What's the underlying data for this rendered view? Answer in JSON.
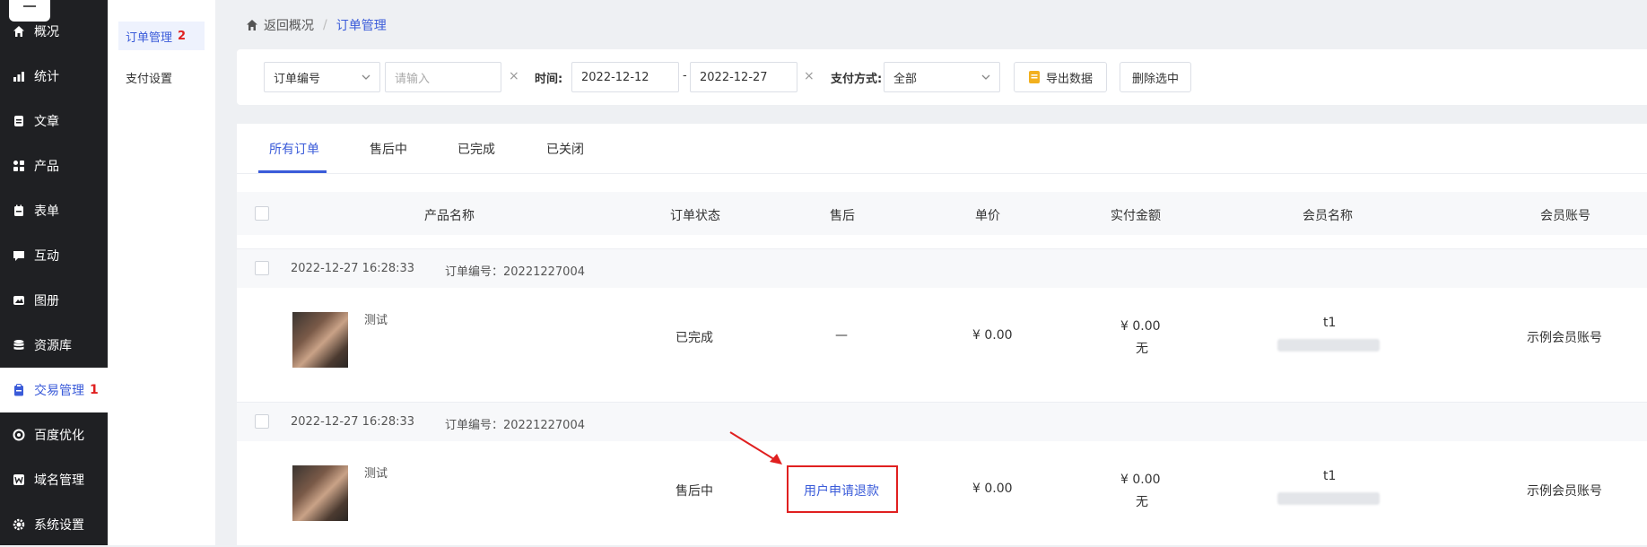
{
  "sidebar": {
    "items": [
      {
        "label": "概况",
        "icon": "home-icon"
      },
      {
        "label": "统计",
        "icon": "chart-icon"
      },
      {
        "label": "文章",
        "icon": "article-icon"
      },
      {
        "label": "产品",
        "icon": "grid-icon"
      },
      {
        "label": "表单",
        "icon": "form-icon"
      },
      {
        "label": "互动",
        "icon": "chat-icon"
      },
      {
        "label": "图册",
        "icon": "gallery-icon"
      },
      {
        "label": "资源库",
        "icon": "database-icon"
      },
      {
        "label": "交易管理",
        "icon": "clipboard-icon",
        "badge": "1",
        "active": true
      },
      {
        "label": "百度优化",
        "icon": "refresh-icon"
      },
      {
        "label": "域名管理",
        "icon": "w-icon"
      },
      {
        "label": "系统设置",
        "icon": "gear-icon"
      }
    ]
  },
  "submenu": {
    "items": [
      {
        "label": "订单管理",
        "badge": "2",
        "active": true
      },
      {
        "label": "支付设置"
      }
    ]
  },
  "breadcrumb": {
    "back": "返回概况",
    "separator": "/",
    "current": "订单管理"
  },
  "filters": {
    "field_select": "订单编号",
    "search_placeholder": "请输入",
    "clear": "×",
    "time_label": "时间:",
    "date_from": "2022-12-12",
    "date_dash": "-",
    "date_to": "2022-12-27",
    "pay_label": "支付方式:",
    "pay_select": "全部",
    "export_button": "导出数据",
    "delete_button": "删除选中"
  },
  "tabs": [
    "所有订单",
    "售后中",
    "已完成",
    "已关闭"
  ],
  "table": {
    "columns": [
      "产品名称",
      "订单状态",
      "售后",
      "单价",
      "实付金额",
      "会员名称",
      "会员账号"
    ]
  },
  "orders": [
    {
      "time": "2022-12-27 16:28:33",
      "order_no": "订单编号：20221227004",
      "product": "测试",
      "status": "已完成",
      "aftersale": "—",
      "price": "¥ 0.00",
      "paid": "¥ 0.00",
      "paid_note": "无",
      "member": "t1",
      "account": "示例会员账号"
    },
    {
      "time": "2022-12-27 16:28:33",
      "order_no": "订单编号：20221227004",
      "product": "测试",
      "status": "售后中",
      "aftersale": "用户申请退款",
      "price": "¥ 0.00",
      "paid": "¥ 0.00",
      "paid_note": "无",
      "member": "t1",
      "account": "示例会员账号"
    }
  ],
  "colors": {
    "accent": "#3a5bd9",
    "badge": "#e02020",
    "sidebar": "#1f2023",
    "annotation": "#e02020"
  }
}
